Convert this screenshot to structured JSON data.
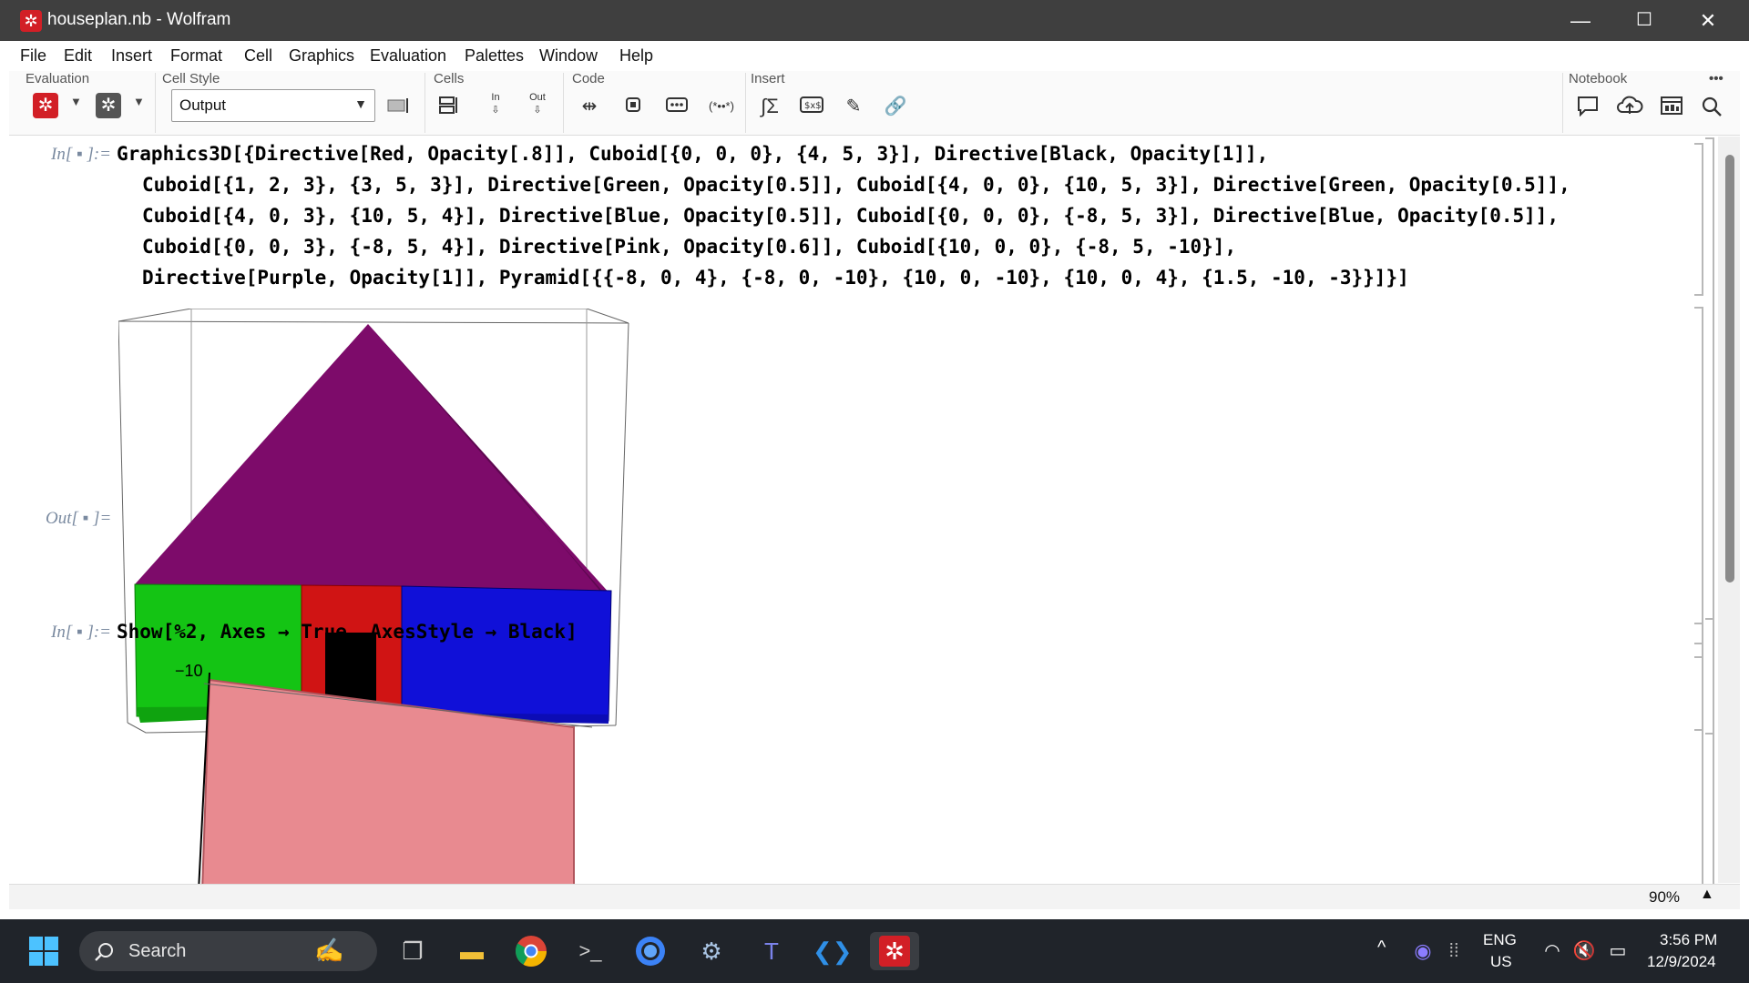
{
  "window": {
    "title": "houseplan.nb - Wolfram"
  },
  "window_controls": {
    "minimize": "—",
    "maximize": "☐",
    "close": "✕"
  },
  "menu": [
    "File",
    "Edit",
    "Insert",
    "Format",
    "Cell",
    "Graphics",
    "Evaluation",
    "Palettes",
    "Window",
    "Help"
  ],
  "toolbar": {
    "evaluation_label": "Evaluation",
    "cell_style_label": "Cell Style",
    "cell_style_value": "Output",
    "cells_label": "Cells",
    "code_label": "Code",
    "insert_label": "Insert",
    "notebook_label": "Notebook",
    "in_glyph": "In",
    "out_glyph": "Out",
    "more": "•••"
  },
  "cells": {
    "in1_label": "In[ ▪ ]:=",
    "in1_lines": [
      "Graphics3D[{Directive[Red, Opacity[.8]], Cuboid[{0, 0, 0}, {4, 5, 3}], Directive[Black, Opacity[1]],",
      "Cuboid[{1, 2, 3}, {3, 5, 3}], Directive[Green, Opacity[0.5]], Cuboid[{4, 0, 0}, {10, 5, 3}], Directive[Green, Opacity[0.5]],",
      "Cuboid[{4, 0, 3}, {10, 5, 4}], Directive[Blue, Opacity[0.5]], Cuboid[{0, 0, 0}, {-8, 5, 3}], Directive[Blue, Opacity[0.5]],",
      "Cuboid[{0, 0, 3}, {-8, 5, 4}], Directive[Pink, Opacity[0.6]], Cuboid[{10, 0, 0}, {-8, 5, -10}],",
      "Directive[Purple, Opacity[1]], Pyramid[{{-8, 0, 4}, {-8, 0, -10}, {10, 0, -10}, {10, 0, 4}, {1.5, -10, -3}}]}]"
    ],
    "out1_label": "Out[ ▪ ]=",
    "in2_label": "In[ ▪ ]:=",
    "in2_code": "Show[%2, Axes → True, AxesStyle → Black]",
    "axis_tick": "−10"
  },
  "status": {
    "zoom": "90%",
    "zoom_arrow": "▲"
  },
  "taskbar": {
    "search": "Search",
    "lang_line1": "ENG",
    "lang_line2": "US",
    "time": "3:56 PM",
    "date": "12/9/2024",
    "chevron": "^"
  },
  "colors": {
    "roof": "#7d0b6a",
    "red_wall": "#d01414",
    "green_wall": "#14c414",
    "blue_wall": "#1010d8",
    "door": "#000000",
    "pink_slab": "#e88a90",
    "accent": "#d21f26"
  }
}
